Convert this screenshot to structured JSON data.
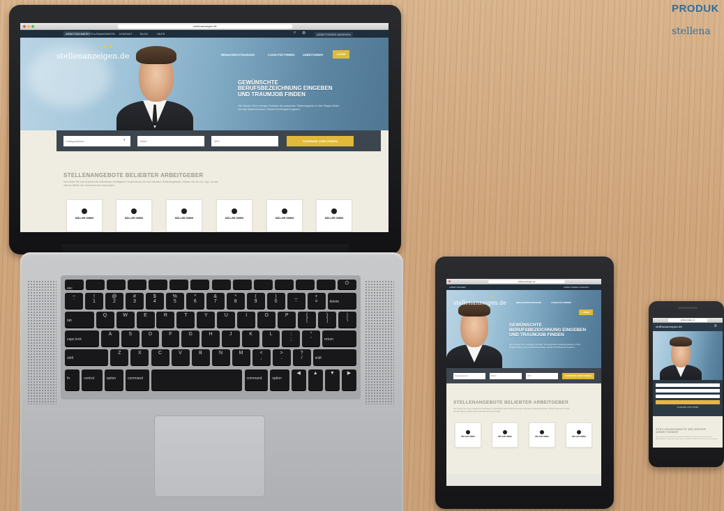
{
  "corner": {
    "title": "PRODUK",
    "subtitle": "stellena"
  },
  "browser": {
    "url": "stellenanzeigen.de"
  },
  "site": {
    "logo": "stellenanzeigen.de",
    "topnav": [
      "ARBEITNEHMER",
      "STELLENANGEBOTE",
      "KONTAKT",
      "BLOG",
      "HILFE"
    ],
    "topnav_right": "ARBEITGEBER ANSEHEN",
    "header_links": [
      "BENACHRICHTIGUNGEN",
      "LOGIN FÜR FIRMEN",
      "ARBEITGEBER"
    ],
    "header_button": "LOGIN",
    "hero": {
      "headline": "GEWÜNSCHTE\nBERUFSBEZEICHNUNG EINGEBEN\nUND TRAUMJOB FINDEN",
      "subline": "Hier können Sie in wenigen Schritten die passenden Stellenangebote in Ihrer Region finden und sich direkt bewerben. Einfach Suchbegriff eingeben."
    },
    "search": {
      "category": "Kategorisieren",
      "was": "Was?",
      "wo": "Wo?",
      "button": "PASSENDE JOBS FINDEN"
    },
    "section_title": "STELLENANGEBOTE BELIEBTER ARBEITGEBER",
    "section_text": "Hier finden Sie eine Auswahl der beliebtesten Arbeitgeber Deutschlands mit ihren aktuellen Stellenangeboten. Klicken Sie auf ein Logo, um alle offenen Stellen des Unternehmens anzuzeigen.",
    "employer_name": "MÜLLER GMBH",
    "employer_cards": 6
  },
  "tablet_site": {
    "headline": "GEWÜNSCHTE\nBERUFSBEZEICHNUNG EINGEBEN\nUND TRAUMJOB FINDEN",
    "section_title": "STELLENANGEBOTE BELIEBTER ARBEITGEBER",
    "search_button": "PASSENDE JOBS FINDEN",
    "employer_name": "MÜLLER GMBH"
  },
  "phone_site": {
    "section_title": "STELLENANGEBOTE BELIEBTER\nARBEITGEBER",
    "search_button": "PASSENDE JOBS FINDEN"
  },
  "keyboard": {
    "row0": [
      "esc",
      "",
      "",
      "",
      "",
      "",
      "",
      "",
      "",
      "",
      "",
      "",
      "",
      "⏻"
    ],
    "row1": [
      "~\n`",
      "!\n1",
      "@\n2",
      "#\n3",
      "$\n4",
      "%\n5",
      "^\n6",
      "&\n7",
      "*\n8",
      "(\n9",
      ")\n0",
      "_\n-",
      "+\n=",
      "delete"
    ],
    "row2": [
      "tab",
      "Q",
      "W",
      "E",
      "R",
      "T",
      "Y",
      "U",
      "I",
      "O",
      "P",
      "{\n[",
      "}\n]",
      "|\n\\"
    ],
    "row3": [
      "caps lock",
      "A",
      "S",
      "D",
      "F",
      "G",
      "H",
      "J",
      "K",
      "L",
      ":\n;",
      "\"\n'",
      "return"
    ],
    "row4": [
      "shift",
      "Z",
      "X",
      "C",
      "V",
      "B",
      "N",
      "M",
      "<\n,",
      ">\n.",
      "?\n/",
      "shift"
    ],
    "row5": [
      "fn",
      "control",
      "option",
      "command",
      "",
      "command",
      "option",
      "◀",
      "▲",
      "▼",
      "▶"
    ]
  },
  "colors": {
    "accent": "#e3b93a",
    "navy": "#1e2e3c",
    "link_blue": "#2f6f9c"
  }
}
